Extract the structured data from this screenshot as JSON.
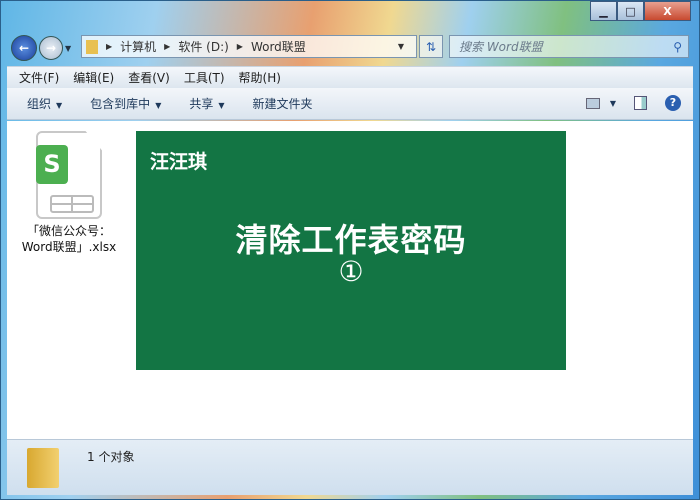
{
  "address": {
    "crumbs": [
      "计算机",
      "软件 (D:)",
      "Word联盟"
    ]
  },
  "search": {
    "placeholder": "搜索 Word联盟"
  },
  "menu": [
    "文件(F)",
    "编辑(E)",
    "查看(V)",
    "工具(T)",
    "帮助(H)"
  ],
  "toolbar": {
    "organize": "组织",
    "include": "包含到库中",
    "share": "共享",
    "new_folder": "新建文件夹"
  },
  "file": {
    "name_line1": "「微信公众号：",
    "name_line2": "Word联盟」.xlsx",
    "icon_letter": "S"
  },
  "preview": {
    "brand": "汪汪琪",
    "title": "清除工作表密码",
    "number": "①",
    "bg": "#137544"
  },
  "status": {
    "count": "1 个对象"
  }
}
